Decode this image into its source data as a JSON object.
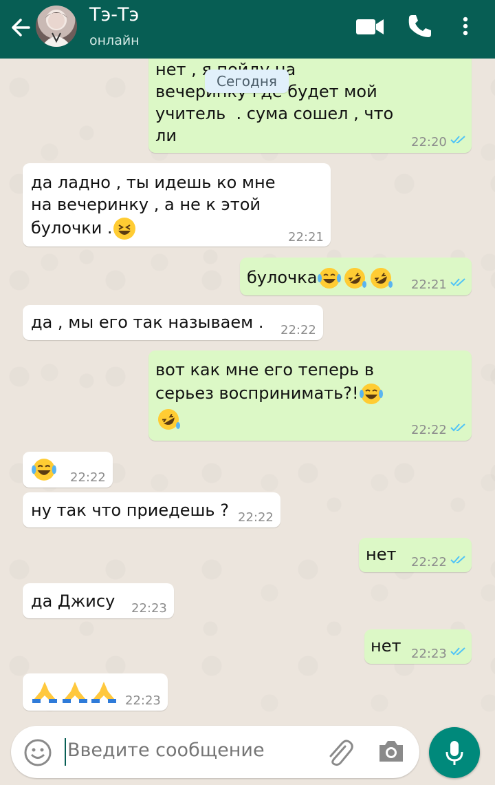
{
  "header": {
    "contact_name": "Тэ-Тэ",
    "status": "онлайн",
    "icons": [
      "back-arrow-icon",
      "video-call-icon",
      "phone-call-icon",
      "more-options-icon"
    ]
  },
  "date_chip": "Сегодня",
  "messages": [
    {
      "direction": "out",
      "lines": [
        "нет , я пойду на",
        "вечеринку где будет мой",
        "учитель  . сума сошел , что",
        "ли"
      ],
      "time": "22:20",
      "read": true
    },
    {
      "direction": "in",
      "lines": [
        "да ладно , ты идешь ко мне",
        "на вечеринку , а не к этой",
        "булочки ."
      ],
      "emoji": [
        "grinning-squinting"
      ],
      "time": "22:21"
    },
    {
      "direction": "out",
      "lines": [
        "булочка"
      ],
      "emoji": [
        "tears-of-joy",
        "rofl",
        "rofl"
      ],
      "time": "22:21",
      "read": true
    },
    {
      "direction": "in",
      "lines": [
        "да , мы его так называем ."
      ],
      "time": "22:22"
    },
    {
      "direction": "out",
      "lines": [
        "вот как мне его теперь в",
        "серьез воспринимать?!"
      ],
      "emoji": [
        "tears-of-joy",
        "rofl"
      ],
      "time": "22:22",
      "read": true
    },
    {
      "direction": "in",
      "lines": [
        ""
      ],
      "emoji": [
        "tears-of-joy"
      ],
      "time": "22:22"
    },
    {
      "direction": "in",
      "lines": [
        "ну так что приедешь ?"
      ],
      "time": "22:22"
    },
    {
      "direction": "out",
      "lines": [
        "нет"
      ],
      "time": "22:22",
      "read": true
    },
    {
      "direction": "in",
      "lines": [
        "да Джису"
      ],
      "time": "22:23"
    },
    {
      "direction": "out",
      "lines": [
        "нет"
      ],
      "time": "22:23",
      "read": true
    },
    {
      "direction": "in",
      "lines": [
        ""
      ],
      "emoji": [
        "folded-hands",
        "folded-hands",
        "folded-hands"
      ],
      "time": "22:23"
    }
  ],
  "input": {
    "placeholder": "Введите сообщение",
    "icons": [
      "emoji-icon",
      "attach-icon",
      "camera-icon",
      "mic-icon"
    ]
  },
  "colors": {
    "header": "#075e54",
    "outgoing_bubble": "#dcf8c6",
    "incoming_bubble": "#ffffff",
    "read_check": "#4fc3f7",
    "mic_button": "#00897b"
  }
}
